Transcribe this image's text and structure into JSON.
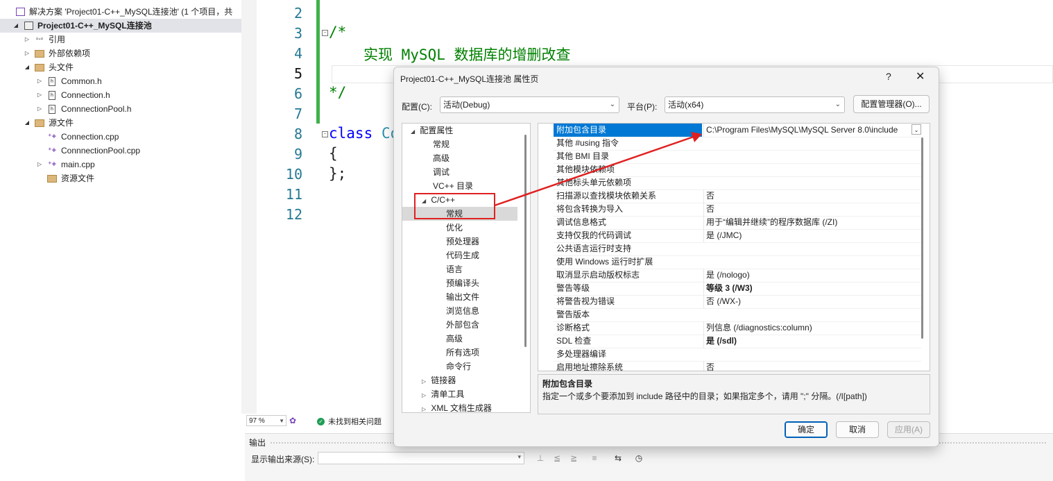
{
  "solution_explorer": {
    "solution_label": "解决方案 'Project01-C++_MySQL连接池' (1 个项目，共",
    "project_label": "Project01-C++_MySQL连接池",
    "references": "引用",
    "external_deps": "外部依赖项",
    "headers_folder": "头文件",
    "headers": [
      "Common.h",
      "Connection.h",
      "ConnnectionPool.h"
    ],
    "sources_folder": "源文件",
    "sources": [
      "Connection.cpp",
      "ConnnectionPool.cpp",
      "main.cpp"
    ],
    "resources_folder": "资源文件"
  },
  "editor": {
    "line_numbers": [
      "2",
      "3",
      "4",
      "5",
      "6",
      "7",
      "8",
      "9",
      "10",
      "11",
      "12"
    ],
    "comment_open": "/*",
    "comment_body": "实现 MySQL 数据库的增删改查",
    "comment_close": "*/",
    "class_keyword": "class",
    "class_name_partial": "Co",
    "brace_open": "{",
    "brace_close": "};"
  },
  "status": {
    "zoom": "97 %",
    "issues": "未找到相关问题"
  },
  "output": {
    "title": "输出",
    "source_label": "显示输出来源(S):",
    "source_value": ""
  },
  "dialog": {
    "title": "Project01-C++_MySQL连接池 属性页",
    "help": "?",
    "close": "✕",
    "config_label": "配置(C):",
    "config_value": "活动(Debug)",
    "platform_label": "平台(P):",
    "platform_value": "活动(x64)",
    "config_manager": "配置管理器(O)...",
    "nav": {
      "root": "配置属性",
      "general": "常规",
      "advanced": "高级",
      "debugging": "调试",
      "vc_dirs": "VC++ 目录",
      "cpp": "C/C++",
      "cpp_general": "常规",
      "optimization": "优化",
      "preprocessor": "预处理器",
      "code_gen": "代码生成",
      "language": "语言",
      "pch": "预编译头",
      "output_files": "输出文件",
      "browse": "浏览信息",
      "external_includes": "外部包含",
      "cpp_advanced": "高级",
      "all_options": "所有选项",
      "command_line": "命令行",
      "linker": "链接器",
      "manifest": "清单工具",
      "xml_doc": "XML 文档生成器"
    },
    "properties": [
      {
        "name": "附加包含目录",
        "value": "C:\\Program Files\\MySQL\\MySQL Server 8.0\\include"
      },
      {
        "name": "其他 #using 指令",
        "value": ""
      },
      {
        "name": "其他 BMI 目录",
        "value": ""
      },
      {
        "name": "其他模块依赖项",
        "value": ""
      },
      {
        "name": "其他标头单元依赖项",
        "value": ""
      },
      {
        "name": "扫描源以查找模块依赖关系",
        "value": "否"
      },
      {
        "name": "将包含转换为导入",
        "value": "否"
      },
      {
        "name": "调试信息格式",
        "value": "用于“编辑并继续”的程序数据库 (/ZI)"
      },
      {
        "name": "支持仅我的代码调试",
        "value": "是 (/JMC)"
      },
      {
        "name": "公共语言运行时支持",
        "value": ""
      },
      {
        "name": "使用 Windows 运行时扩展",
        "value": ""
      },
      {
        "name": "取消显示启动版权标志",
        "value": "是 (/nologo)"
      },
      {
        "name": "警告等级",
        "value": "等级 3 (/W3)"
      },
      {
        "name": "将警告视为错误",
        "value": "否 (/WX-)"
      },
      {
        "name": "警告版本",
        "value": ""
      },
      {
        "name": "诊断格式",
        "value": "列信息 (/diagnostics:column)"
      },
      {
        "name": "SDL 检查",
        "value": "是 (/sdl)"
      },
      {
        "name": "多处理器编译",
        "value": ""
      },
      {
        "name": "启用地址擦除系统",
        "value": "否"
      }
    ],
    "description_title": "附加包含目录",
    "description_text": "指定一个或多个要添加到 include 路径中的目录；如果指定多个，请用 \";\" 分隔。(/I[path])",
    "ok": "确定",
    "cancel": "取消",
    "apply": "应用(A)"
  }
}
